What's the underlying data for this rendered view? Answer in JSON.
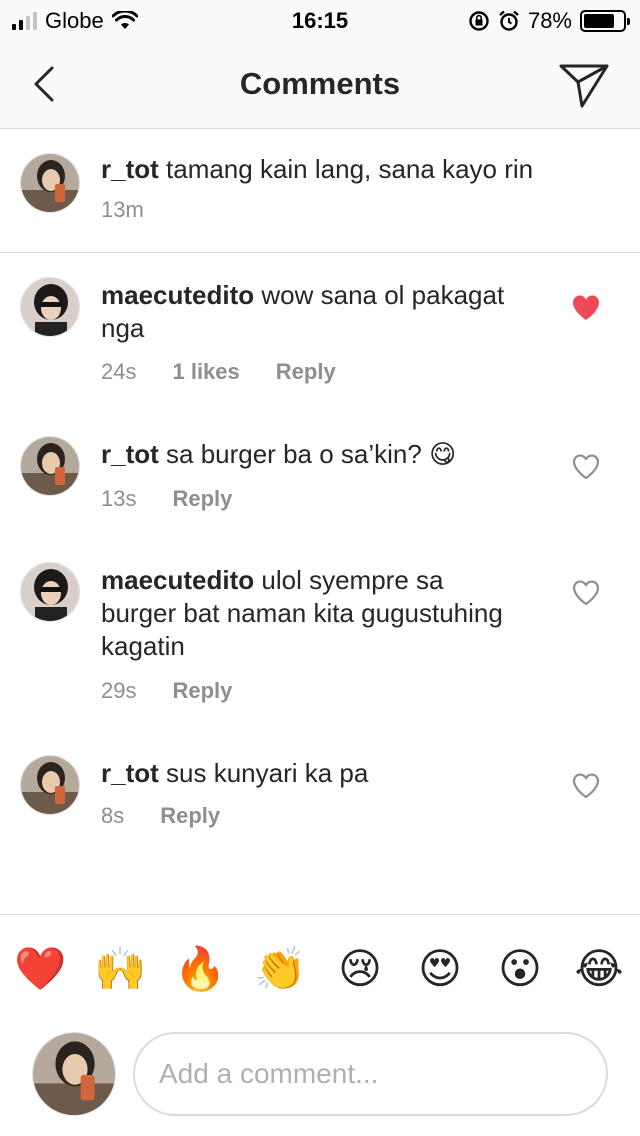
{
  "status_bar": {
    "carrier": "Globe",
    "time": "16:15",
    "battery_percent": "78%",
    "battery_level": 0.78,
    "signal_bars_filled": 2,
    "signal_bars_total": 4
  },
  "nav": {
    "title": "Comments",
    "back_icon": "chevron-left-icon",
    "send_icon": "paper-plane-icon"
  },
  "caption": {
    "username": "r_tot",
    "text": " tamang kain lang, sana kayo rin",
    "time": "13m"
  },
  "comments": [
    {
      "username": "maecutedito",
      "text": " wow sana ol pakagat nga",
      "time": "24s",
      "likes": "1 likes",
      "reply": "Reply",
      "liked": true
    },
    {
      "username": "r_tot",
      "text": " sa burger ba o sa’kin?",
      "emoji": "😋",
      "time": "13s",
      "reply": "Reply",
      "liked": false
    },
    {
      "username": "maecutedito",
      "text": " ulol syempre sa burger bat naman kita gugustuhing kagatin",
      "time": "29s",
      "reply": "Reply",
      "liked": false
    },
    {
      "username": "r_tot",
      "text": " sus kunyari ka pa",
      "time": "8s",
      "reply": "Reply",
      "liked": false
    }
  ],
  "emoji_bar": [
    "❤️",
    "🙌",
    "🔥",
    "👏",
    "😢",
    "😍",
    "😮",
    "😂"
  ],
  "input": {
    "placeholder": "Add a comment..."
  },
  "colors": {
    "liked_heart": "#ed4956",
    "secondary_text": "#8e8e8e",
    "divider": "#dbdbdb"
  }
}
